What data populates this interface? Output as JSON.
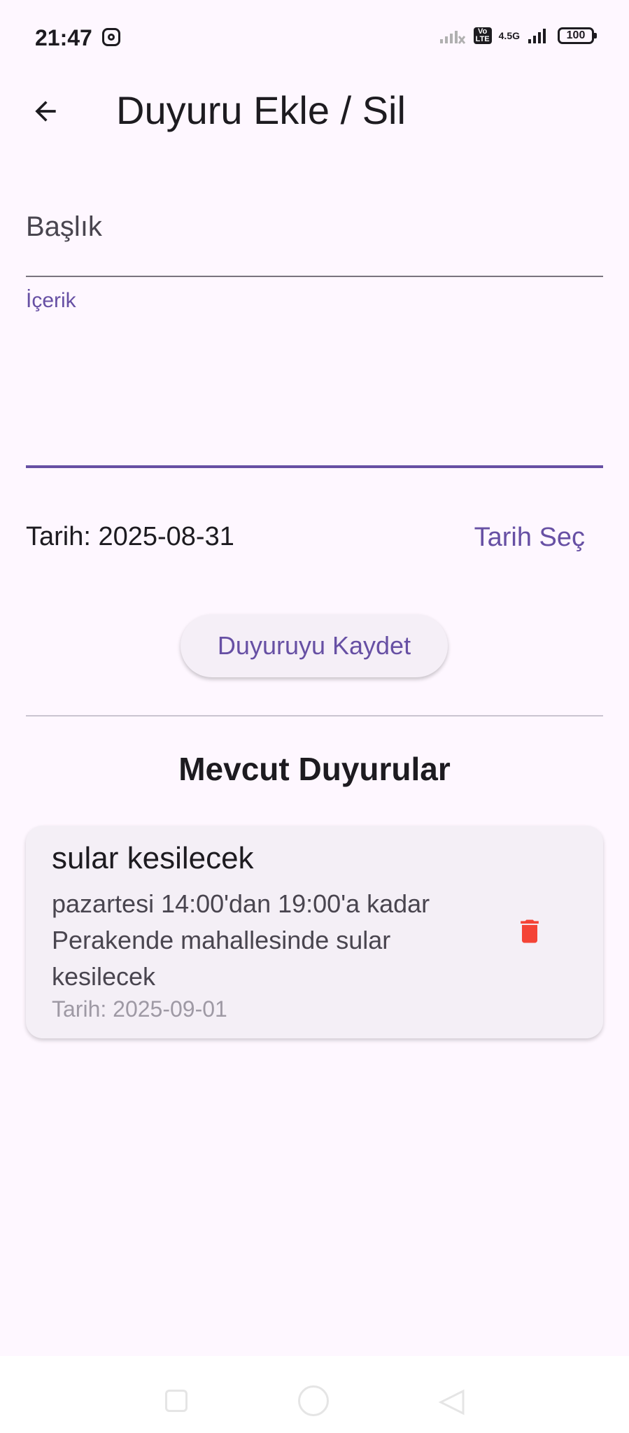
{
  "status_bar": {
    "time": "21:47",
    "network_label": "4.5G",
    "volte_label": "Vo\nLTE",
    "battery": "100",
    "icons": [
      "instagram-icon",
      "signal-muted-icon",
      "volte-icon",
      "signal-icon",
      "battery-icon"
    ]
  },
  "app_bar": {
    "title": "Duyuru Ekle / Sil",
    "back_icon": "arrow-back-icon"
  },
  "form": {
    "title_label": "Başlık",
    "title_value": "",
    "content_label": "İçerik",
    "content_value": "",
    "date_text": "Tarih: 2025-08-31",
    "pick_date_label": "Tarih Seç",
    "save_label": "Duyuruyu Kaydet"
  },
  "list": {
    "section_title": "Mevcut Duyurular",
    "items": [
      {
        "title": "sular kesilecek",
        "body": "pazartesi 14:00'dan 19:00'a kadar Perakende mahallesinde sular kesilecek",
        "date": "Tarih: 2025-09-01",
        "delete_icon": "trash-icon"
      }
    ]
  },
  "colors": {
    "background": "#FEF7FF",
    "primary": "#6750A4",
    "delete": "#F44336",
    "card": "#F4EFF6"
  }
}
